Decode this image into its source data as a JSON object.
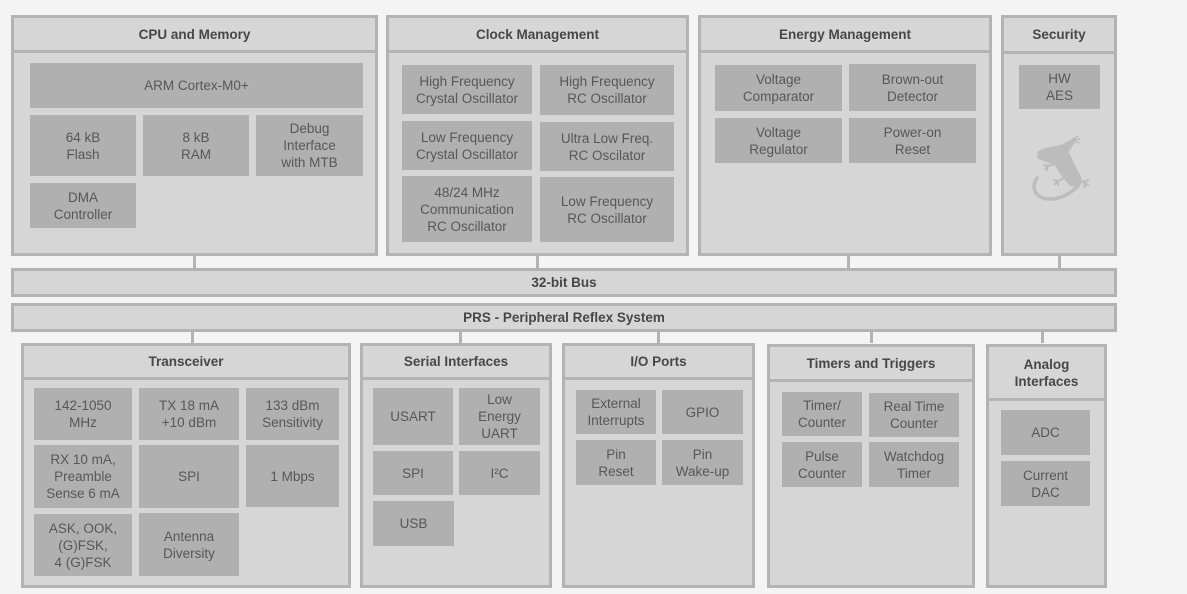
{
  "cpu": {
    "title": "CPU and Memory",
    "blocks": [
      "ARM Cortex-M0+",
      "64 kB\nFlash",
      "8 kB\nRAM",
      "Debug\nInterface\nwith MTB",
      "DMA\nController"
    ]
  },
  "clock": {
    "title": "Clock Management",
    "blocks": [
      "High Frequency\nCrystal Oscillator",
      "High Frequency\nRC Oscillator",
      "Low Frequency\nCrystal Oscillator",
      "Ultra Low Freq.\nRC Oscilator",
      "48/24 MHz\nCommunication\nRC Oscillator",
      "Low Frequency\nRC Oscillator"
    ]
  },
  "energy": {
    "title": "Energy Management",
    "blocks": [
      "Voltage\nComparator",
      "Brown-out\nDetector",
      "Voltage\nRegulator",
      "Power-on\nReset"
    ]
  },
  "security": {
    "title": "Security",
    "blocks": [
      "HW\nAES"
    ],
    "logo_icon": "gecko-icon"
  },
  "bus": {
    "label": "32-bit Bus"
  },
  "prs": {
    "label": "PRS - Peripheral Reflex System"
  },
  "transceiver": {
    "title": "Transceiver",
    "blocks": [
      "142-1050\nMHz",
      "TX 18 mA\n+10 dBm",
      "133 dBm\nSensitivity",
      "RX 10 mA,\nPreamble\nSense 6 mA",
      "SPI",
      "1 Mbps",
      "ASK, OOK,\n(G)FSK,\n4 (G)FSK",
      "Antenna\nDiversity"
    ]
  },
  "serial": {
    "title": "Serial Interfaces",
    "blocks": [
      "USART",
      "Low\nEnergy\nUART",
      "SPI",
      "I²C",
      "USB"
    ]
  },
  "io": {
    "title": "I/O Ports",
    "blocks": [
      "External\nInterrupts",
      "GPIO",
      "Pin\nReset",
      "Pin\nWake-up"
    ]
  },
  "timers": {
    "title": "Timers and Triggers",
    "blocks": [
      "Timer/\nCounter",
      "Real Time\nCounter",
      "Pulse\nCounter",
      "Watchdog\nTimer"
    ]
  },
  "analog": {
    "title": "Analog\nInterfaces",
    "blocks": [
      "ADC",
      "Current\nDAC"
    ]
  },
  "colors": {
    "background": "#f4f4f4",
    "panel": "#d6d6d6",
    "border": "#b3b3b3",
    "block": "#b0b0b0",
    "header_text": "#474747",
    "block_text": "#575757"
  }
}
